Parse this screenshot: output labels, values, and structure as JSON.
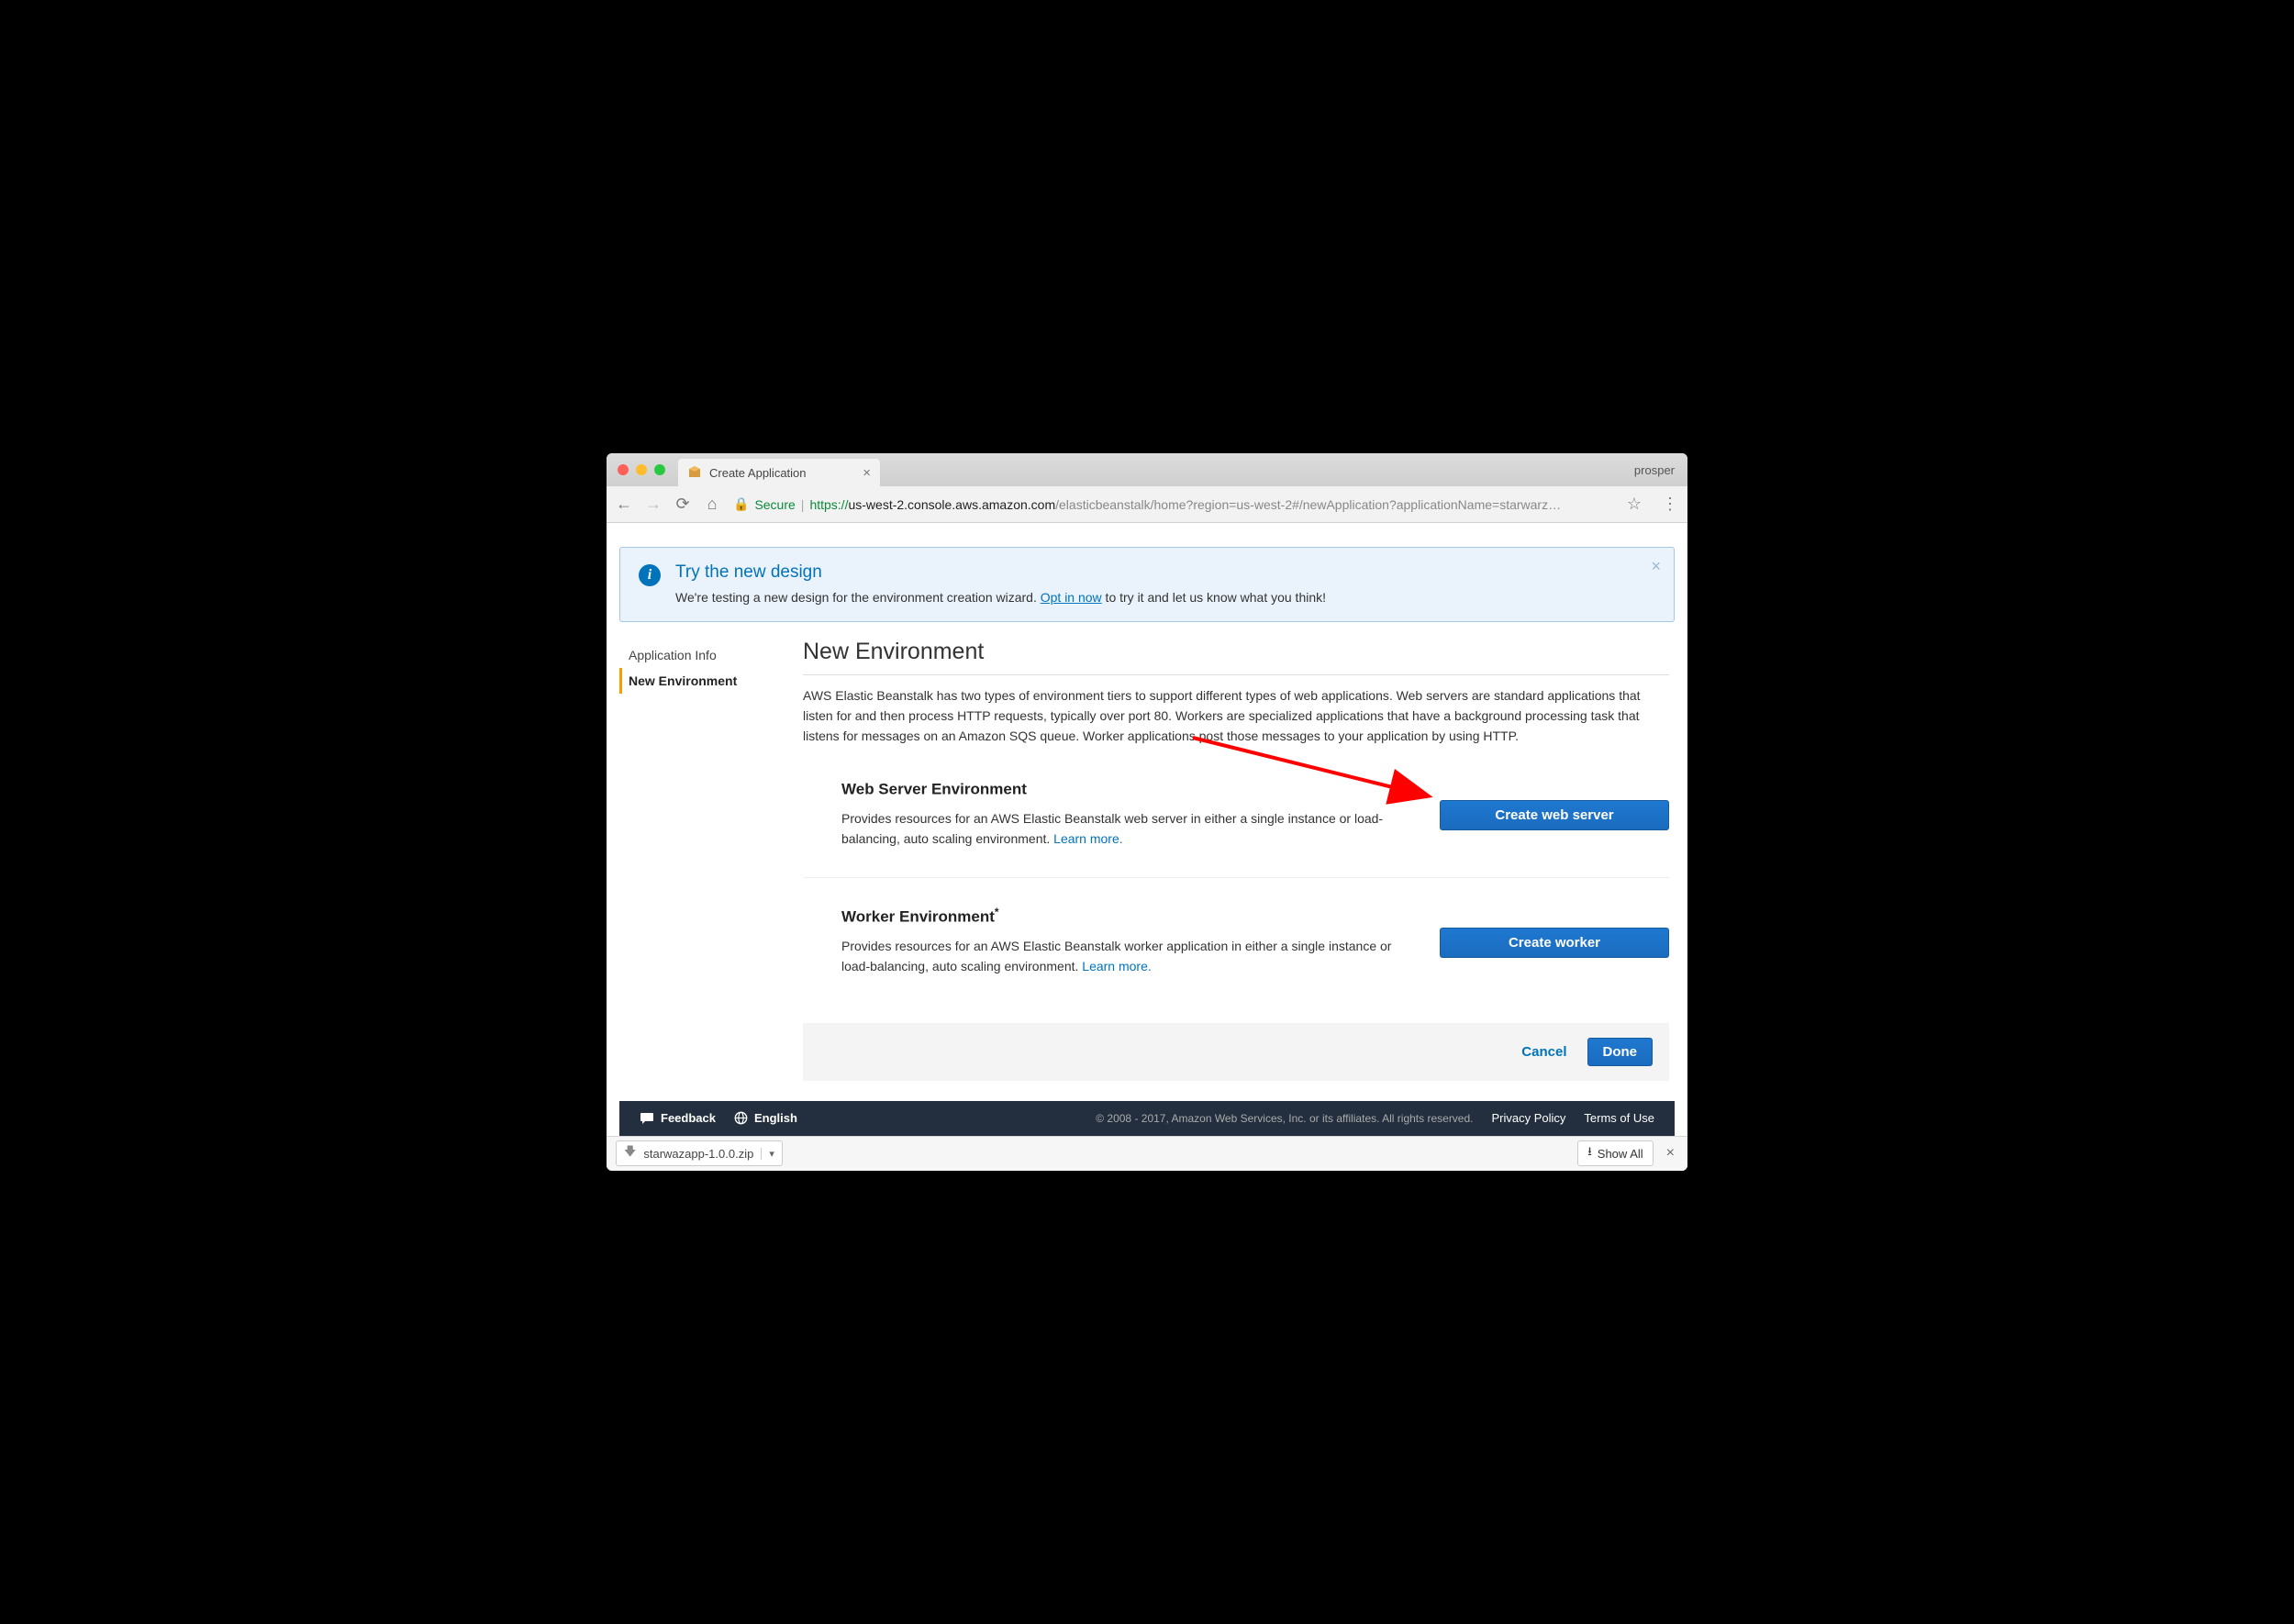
{
  "browser": {
    "profile": "prosper",
    "tab_title": "Create Application",
    "secure_label": "Secure",
    "url_scheme": "https://",
    "url_host": "us-west-2.console.aws.amazon.com",
    "url_path": "/elasticbeanstalk/home?region=us-west-2#/newApplication?applicationName=starwarz…"
  },
  "alert": {
    "title": "Try the new design",
    "body_prefix": "We're testing a new design for the environment creation wizard. ",
    "link": "Opt in now",
    "body_suffix": " to try it and let us know what you think!"
  },
  "sidebar": {
    "items": [
      {
        "label": "Application Info"
      },
      {
        "label": "New Environment"
      }
    ],
    "active_index": 1
  },
  "page": {
    "heading": "New Environment",
    "description": "AWS Elastic Beanstalk has two types of environment tiers to support different types of web applications. Web servers are standard applications that listen for and then process HTTP requests, typically over port 80. Workers are specialized applications that have a background processing task that listens for messages on an Amazon SQS queue. Worker applications post those messages to your application by using HTTP."
  },
  "envs": [
    {
      "title": "Web Server Environment",
      "asterisk": "",
      "text": "Provides resources for an AWS Elastic Beanstalk web server in either a single instance or load-balancing, auto scaling environment. ",
      "learn_more": "Learn more.",
      "button": "Create web server"
    },
    {
      "title": "Worker Environment",
      "asterisk": "*",
      "text": "Provides resources for an AWS Elastic Beanstalk worker application in either a single instance or load-balancing, auto scaling environment. ",
      "learn_more": "Learn more.",
      "button": "Create worker"
    }
  ],
  "actions": {
    "cancel": "Cancel",
    "done": "Done"
  },
  "footer": {
    "feedback": "Feedback",
    "language": "English",
    "copyright": "© 2008 - 2017, Amazon Web Services, Inc. or its affiliates. All rights reserved.",
    "privacy": "Privacy Policy",
    "terms": "Terms of Use"
  },
  "downloads": {
    "file": "starwazapp-1.0.0.zip",
    "show_all": "Show All"
  }
}
